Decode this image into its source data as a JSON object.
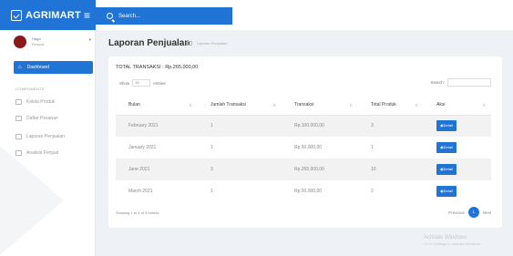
{
  "app": {
    "brand": "AGRIMART",
    "menu_icon": "hamburger-icon",
    "accent_color": "#1f74d6"
  },
  "topbar": {
    "search_placeholder": "Search..."
  },
  "sidebar": {
    "user_name": "Haga",
    "user_role": "Penjual",
    "dashboard_label": "Dashboard",
    "section_label": "COMPONENTS",
    "items": [
      {
        "label": "Kelola Produk"
      },
      {
        "label": "Daftar Pesanan"
      },
      {
        "label": "Laporan Penjualan"
      },
      {
        "label": "Analisis Penjual"
      }
    ]
  },
  "page": {
    "title": "Laporan Penjualan",
    "breadcrumb": "Laporan Penjualan",
    "total_label": "TOTAL TRANSAKSI : Rp.265.000,00",
    "show_label": "Show",
    "entries_value": "10",
    "entries_label": "entries",
    "search_label": "Search:"
  },
  "table": {
    "headers": [
      "Bulan",
      "Jumlah Transaksi",
      "Transaksi",
      "Total Produk",
      "Aksi"
    ],
    "rows": [
      {
        "bulan": "February 2021",
        "jumlah": "1",
        "transaksi": "Rp.100.000,00",
        "produk": "3",
        "aksi": "Detail"
      },
      {
        "bulan": "January 2021",
        "jumlah": "1",
        "transaksi": "Rp.50.000,00",
        "produk": "1",
        "aksi": "Detail"
      },
      {
        "bulan": "June 2021",
        "jumlah": "3",
        "transaksi": "Rp.265.000,00",
        "produk": "10",
        "aksi": "Detail"
      },
      {
        "bulan": "March 2021",
        "jumlah": "1",
        "transaksi": "Rp.50.000,00",
        "produk": "2",
        "aksi": "Detail"
      }
    ]
  },
  "footer": {
    "info": "Showing 1 to 4 of 4 entries",
    "previous": "Previous",
    "page": "1",
    "next": "Next"
  },
  "watermark": {
    "line1": "Activate Windows",
    "line2": "Go to Settings to activate Windows."
  }
}
